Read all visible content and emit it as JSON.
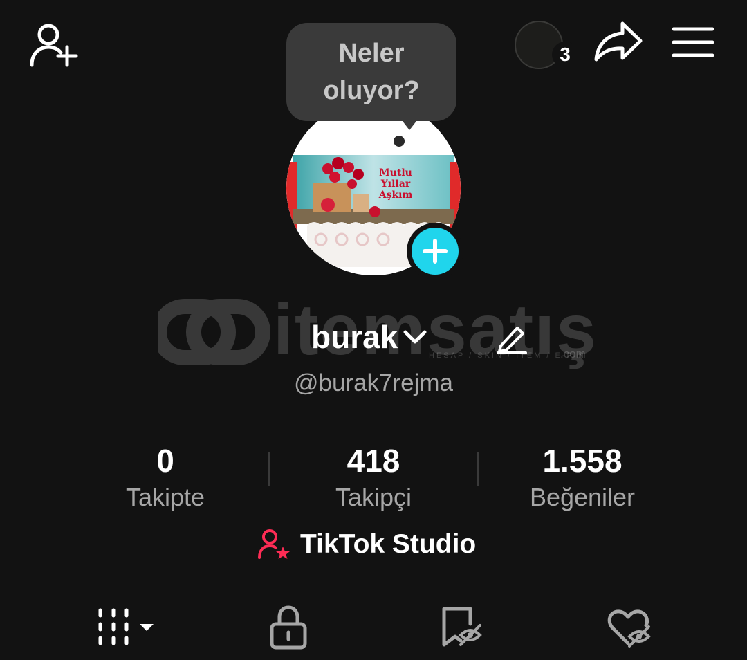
{
  "header": {
    "add_friend_icon": "person-plus-icon",
    "story_count": "3",
    "share_icon": "share-arrow-icon",
    "menu_icon": "hamburger-menu-icon"
  },
  "bubble": {
    "text": "Neler oluyor?"
  },
  "profile": {
    "avatar_caption": [
      "Mutlu",
      "Yıllar",
      "Aşkım"
    ],
    "name": "burak",
    "handle": "@burak7rejma",
    "accent_color": "#20d5ec"
  },
  "watermark": {
    "brand": "itemsatış",
    "tagline": "HESAP / SKIN / ITEM / E-PIN",
    "domain": ".com"
  },
  "stats": [
    {
      "value": "0",
      "label": "Takipte"
    },
    {
      "value": "418",
      "label": "Takipçi"
    },
    {
      "value": "1.558",
      "label": "Beğeniler"
    }
  ],
  "studio": {
    "label": "TikTok Studio",
    "icon_color": "#fe2c55"
  },
  "tabs": [
    {
      "icon": "videos-grid-icon",
      "selected": true
    },
    {
      "icon": "lock-icon",
      "selected": false
    },
    {
      "icon": "bookmark-hidden-icon",
      "selected": false
    },
    {
      "icon": "liked-hidden-icon",
      "selected": false
    }
  ]
}
